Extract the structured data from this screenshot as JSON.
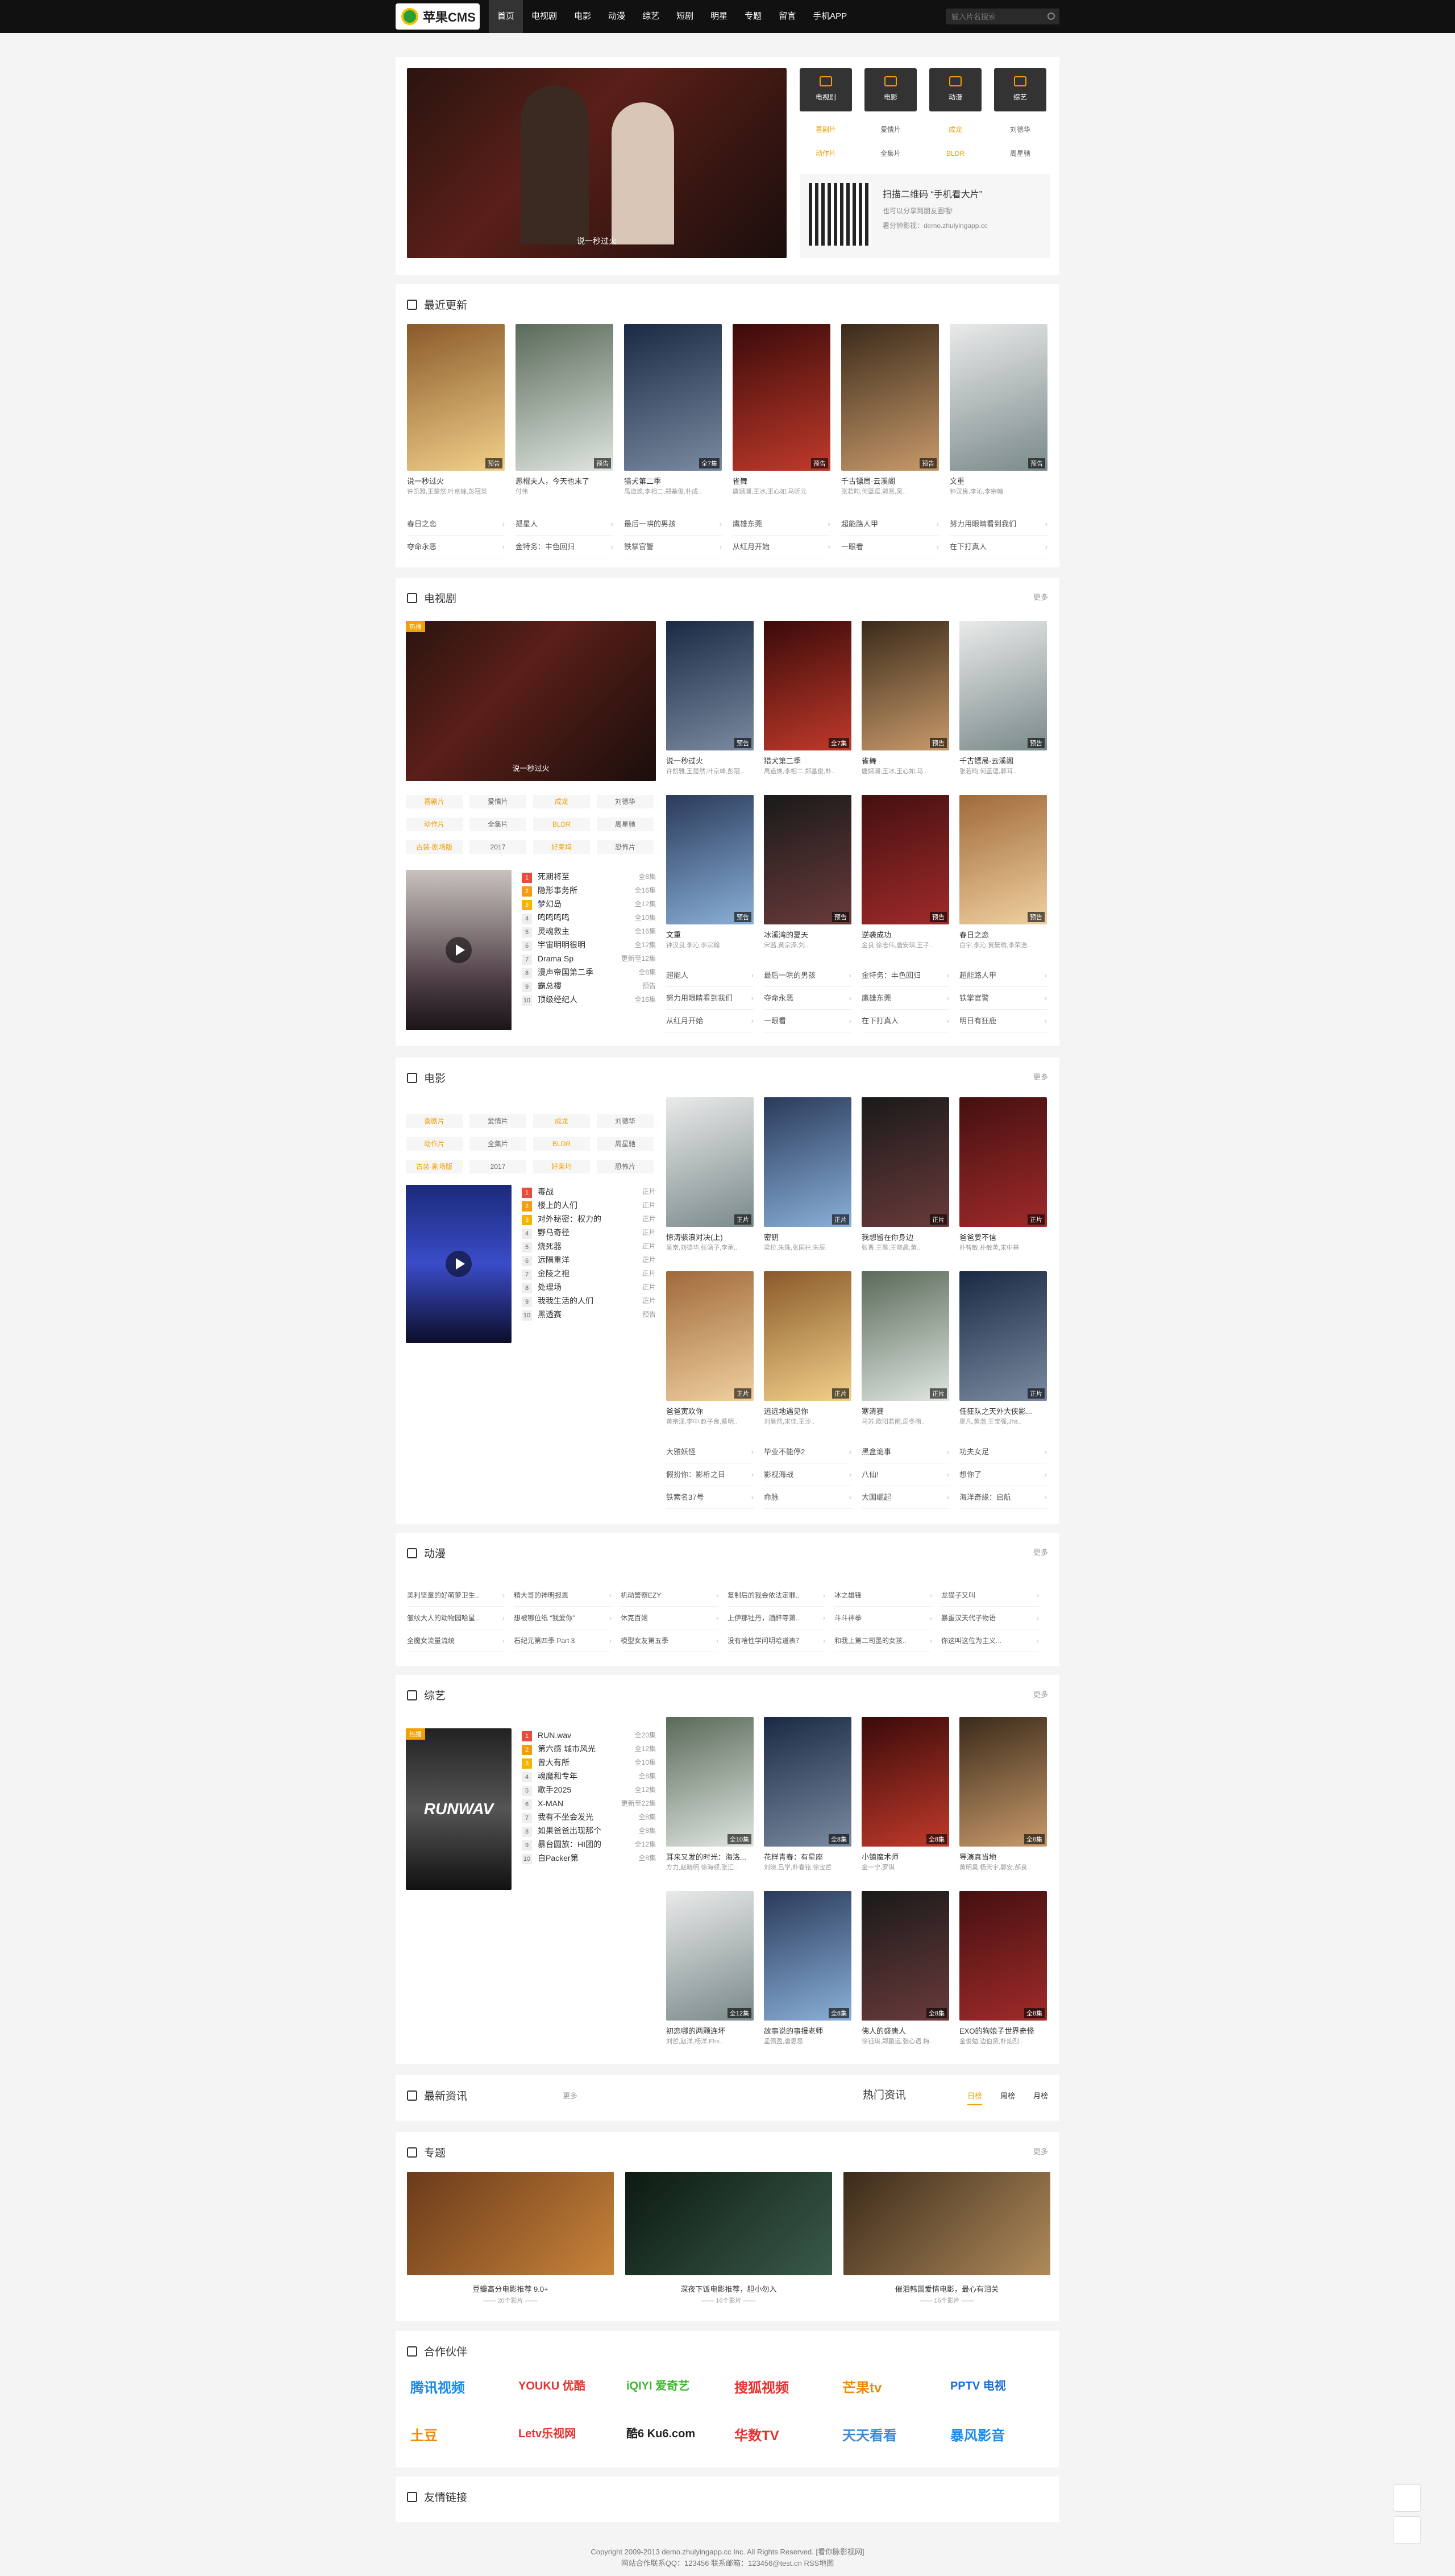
{
  "brand": {
    "name": "苹果CMS"
  },
  "nav": [
    "首页",
    "电视剧",
    "电影",
    "动漫",
    "综艺",
    "短剧",
    "明星",
    "专题",
    "留言",
    "手机APP"
  ],
  "search": {
    "placeholder": "输入片名搜索"
  },
  "hero": {
    "caption": "说一秒过火",
    "quick": [
      "电视剧",
      "电影",
      "动漫",
      "综艺"
    ],
    "tags": [
      "喜剧片",
      "爱情片",
      "成龙",
      "刘德华",
      "动作片",
      "全集片",
      "BLDR",
      "周星驰"
    ],
    "qr": {
      "title": "扫描二维码 “手机看大片”",
      "line1": "也可以分享到朋友圈哦!",
      "line2": "看分钟影视：demo.zhulyingapp.cc"
    }
  },
  "latest": {
    "title": "最近更新",
    "items": [
      {
        "t": "说一秒过火",
        "s": "许凯雅,王楚然,叶京峰,彭冠英",
        "b": "预告"
      },
      {
        "t": "恶棍夫人，今天也末了",
        "s": "付伟",
        "b": "预告"
      },
      {
        "t": "猎犬第二季",
        "s": "禹道焕,李相二,郑基俊,朴成..",
        "b": "全7集"
      },
      {
        "t": "雀舞",
        "s": "唐嫣潮,王冰,王心如,马昕元",
        "b": "预告"
      },
      {
        "t": "千古镖局·云溪阁",
        "s": "张若昀,何蓝逗,郭耳,吴..",
        "b": "预告"
      },
      {
        "t": "文重",
        "s": "钟汉良,李沁,李宗翰",
        "b": "预告"
      }
    ],
    "links": [
      [
        "春日之恋",
        "孤星人",
        "最后一哄的男孩",
        "鹰雄东莞",
        "超能路人甲",
        "努力用眼睛看到我们"
      ],
      [
        "夺命永恶",
        "金特务：丰色回归",
        "铁掌官警",
        "从红月开始",
        "一眼看",
        "在下打真人"
      ]
    ]
  },
  "tv": {
    "title": "电视剧",
    "more": "更多",
    "featured": "说一秒过火",
    "hot": "热播",
    "tags": [
      "喜剧片",
      "爱情片",
      "成龙",
      "刘德华",
      "动作片",
      "全集片",
      "BLDR",
      "周星驰",
      "古装·剧场版",
      "2017",
      "好莱坞",
      "恐怖片"
    ],
    "posters": [
      {
        "t": "说一秒过火",
        "s": "许凯雅,王楚然,叶京峰,彭冠..",
        "b": "预告"
      },
      {
        "t": "猎犬第二季",
        "s": "禹道焕,李相二,郑基俊,朴..",
        "b": "全7集"
      },
      {
        "t": "雀舞",
        "s": "唐嫣潮,王冰,王心如,马..",
        "b": "预告"
      },
      {
        "t": "千古镖局·云溪阁",
        "s": "张若昀,何蓝逗,郭耳..",
        "b": "预告"
      },
      {
        "t": "文重",
        "s": "钟汉良,李沁,李宗翰",
        "b": "预告"
      },
      {
        "t": "冰溪湾的夏天",
        "s": "宋茜,黄宗泽,刘..",
        "b": "预告"
      },
      {
        "t": "逆袭成功",
        "s": "金良,徐志伟,唐安琪,王子..",
        "b": "预告"
      },
      {
        "t": "春日之恋",
        "s": "白宇,李沁,黄景瑜,李荣浩..",
        "b": "预告"
      }
    ],
    "rank": [
      [
        "死期将至",
        "全8集"
      ],
      [
        "隐形事务所",
        "全16集"
      ],
      [
        "梦幻岛",
        "全12集"
      ],
      [
        "鸣鸣鸣鸣",
        "全10集"
      ],
      [
        "灵魂救主",
        "全16集"
      ],
      [
        "宇宙明明很明",
        "全12集"
      ],
      [
        "Drama Sp",
        "更新至12集"
      ],
      [
        "漫声帝国第二季",
        "全8集"
      ],
      [
        "霸总樓",
        "预告"
      ],
      [
        "顶级经纪人",
        "全16集"
      ]
    ],
    "links": [
      [
        "超能人",
        "最后一哄的男孩",
        "金特务：丰色回归",
        "超能路人甲"
      ],
      [
        "努力用眼睛看到我们",
        "夺命永恶",
        "鹰雄东莞",
        "铁掌官警"
      ],
      [
        "从红月开始",
        "一眼看",
        "在下打真人",
        "明日有狂鹿"
      ]
    ]
  },
  "movie": {
    "title": "电影",
    "more": "更多",
    "hot": "热播",
    "tags": [
      "喜剧片",
      "爱情片",
      "成龙",
      "刘德华",
      "动作片",
      "全集片",
      "BLDR",
      "周星驰",
      "古装·剧场版",
      "2017",
      "好莱坞",
      "恐怖片"
    ],
    "rank": [
      [
        "毒战",
        "正片"
      ],
      [
        "楼上的人们",
        "正片"
      ],
      [
        "对外秘密：权力的",
        "正片"
      ],
      [
        "野马奇径",
        "正片"
      ],
      [
        "烧死器",
        "正片"
      ],
      [
        "远隔重洋",
        "正片"
      ],
      [
        "金陵之袍",
        "正片"
      ],
      [
        "处理场",
        "正片"
      ],
      [
        "我我生活的人们",
        "正片"
      ],
      [
        "黑透赛",
        "预告"
      ]
    ],
    "posters": [
      {
        "t": "惊涛骇浪对决(上)",
        "s": "吴京,刘德华,张涵予,李承..",
        "b": "正片"
      },
      {
        "t": "密钥",
        "s": "梁拉,朱珠,张国柱,朱辰.",
        "b": "正片"
      },
      {
        "t": "我想留在你身边",
        "s": "张晋,王晨,王晓晨,黄..",
        "b": "正片"
      },
      {
        "t": "爸爸要不信",
        "s": "朴智敏,朴敏英,宋中基",
        "b": "正片"
      },
      {
        "t": "爸爸寅欢你",
        "s": "黄宗泽,李中,赵子良,蔡明..",
        "b": "正片"
      },
      {
        "t": "远远地遇见你",
        "s": "刘昊然,宋佳,王沙..",
        "b": "正片"
      },
      {
        "t": "寒清赛",
        "s": "马苏,欧阳若雨,周冬雨..",
        "b": "正片"
      },
      {
        "t": "任狂队之天外大侠影...",
        "s": "廖凡,黄渤,王宝强,Jhs..",
        "b": "正片"
      }
    ],
    "links": [
      [
        "大雅妖怪",
        "毕业不能停2",
        "黑盒诡事",
        "功夫女足"
      ],
      [
        "假扮你：影析之日",
        "影视海战",
        "八仙!",
        "想你了"
      ],
      [
        "铁索名37号",
        "命脉",
        "大国崛起",
        "海洋奇缘：启航"
      ]
    ]
  },
  "anime": {
    "title": "动漫",
    "more": "更多",
    "links": [
      [
        "美利坚童的好萌萝卫生..",
        "精大哥的神明报恩",
        "机动警察EZY",
        "复制后的我会依法定罪..",
        "冰之雄锋",
        "龙猫子又叫"
      ],
      [
        "皱纹大人的动物园哈星..",
        "想被哪位纸 “我爱你”",
        "休克百姬",
        "上伊那牡丹，酒醉寺萧..",
        "斗斗神拳",
        "暴蛋汉天代子物语"
      ],
      [
        "全魔女流量流统",
        "石纪元第四季 Part 3",
        "模型女友第五季",
        "没有啥性学问明哈道表？",
        "和我上第二司墨的女孩..",
        "你这叫这位为主义..."
      ]
    ]
  },
  "variety": {
    "title": "综艺",
    "more": "更多",
    "featured": "RUNWAV",
    "hot": "热播",
    "rank": [
      [
        "RUN.wav",
        "全20集"
      ],
      [
        "第六感 城市风光",
        "全12集"
      ],
      [
        "曾大有所",
        "全10集"
      ],
      [
        "魂魔和专年",
        "全8集"
      ],
      [
        "歌手2025",
        "全12集"
      ],
      [
        "X-MAN",
        "更新至22集"
      ],
      [
        "我有不坐会发光",
        "全8集"
      ],
      [
        "如果爸爸出现那个",
        "全8集"
      ],
      [
        "暴台圆旅：HI团的",
        "全12集"
      ],
      [
        "自Packer第",
        "全8集"
      ]
    ],
    "posters": [
      {
        "t": "耳来又发的时光：海洛...",
        "s": "方力,赵晓明,徐海顿,张汇..",
        "b": "全10集"
      },
      {
        "t": "花样青春：有星座",
        "s": "刘晓,吕学,朴春铭,徐宝哲",
        "b": "全8集"
      },
      {
        "t": "小镇魔术师",
        "s": "金一宁,罗琪",
        "b": "全8集"
      },
      {
        "t": "导演真当地",
        "s": "黄明昊,杨天宇,郭安,郝良..",
        "b": "全8集"
      },
      {
        "t": "初恋哪的两颗连坏",
        "s": "刘哲,赵洋,杨洋,Ehs..",
        "b": "全12集"
      },
      {
        "t": "故事说的事报老师",
        "s": "孟佩盈,唐思思",
        "b": "全8集"
      },
      {
        "t": "佛人的盛唐人",
        "s": "徐钰琪,郑鹏远,张心语,梅..",
        "b": "全8集"
      },
      {
        "t": "EXO的狗娘子世界奇怪",
        "s": "金俊勉,边伯贤,朴灿烈..",
        "b": "全8集"
      }
    ]
  },
  "news": {
    "title": "最新资讯",
    "more": "更多",
    "hot": "热门资讯",
    "tabs": [
      "日榜",
      "周榜",
      "月榜"
    ]
  },
  "topics": {
    "title": "专题",
    "more": "更多",
    "items": [
      {
        "t": "豆瓣高分电影推荐 9.0+",
        "c": "—— 20个影片 ——"
      },
      {
        "t": "深夜下饭电影推荐，胆小勿入",
        "c": "—— 16个影片 ——"
      },
      {
        "t": "催泪韩国爱情电影，最心有泪关",
        "c": "—— 16个影片 ——"
      }
    ]
  },
  "partners": {
    "title": "合作伙伴",
    "items": [
      "腾讯视频",
      "YOUKU 优酷",
      "iQIYI 爱奇艺",
      "搜狐视频",
      "芒果tv",
      "PPTV 电视",
      "土豆",
      "Letv乐视网",
      "酷6 Ku6.com",
      "华数TV",
      "天天看看",
      "暴风影音"
    ]
  },
  "friends": {
    "title": "友情链接"
  },
  "footer": {
    "line1": "Copyright 2009-2013 demo.zhulyingapp.cc Inc. All Rights Reserved. [看你脉影视网]",
    "line2": "网站合作联系QQ：123456 联系邮箱：123456@test.cn RSS地图"
  },
  "colors": {
    "accent": "#f0a000",
    "topbar": "#111111"
  }
}
